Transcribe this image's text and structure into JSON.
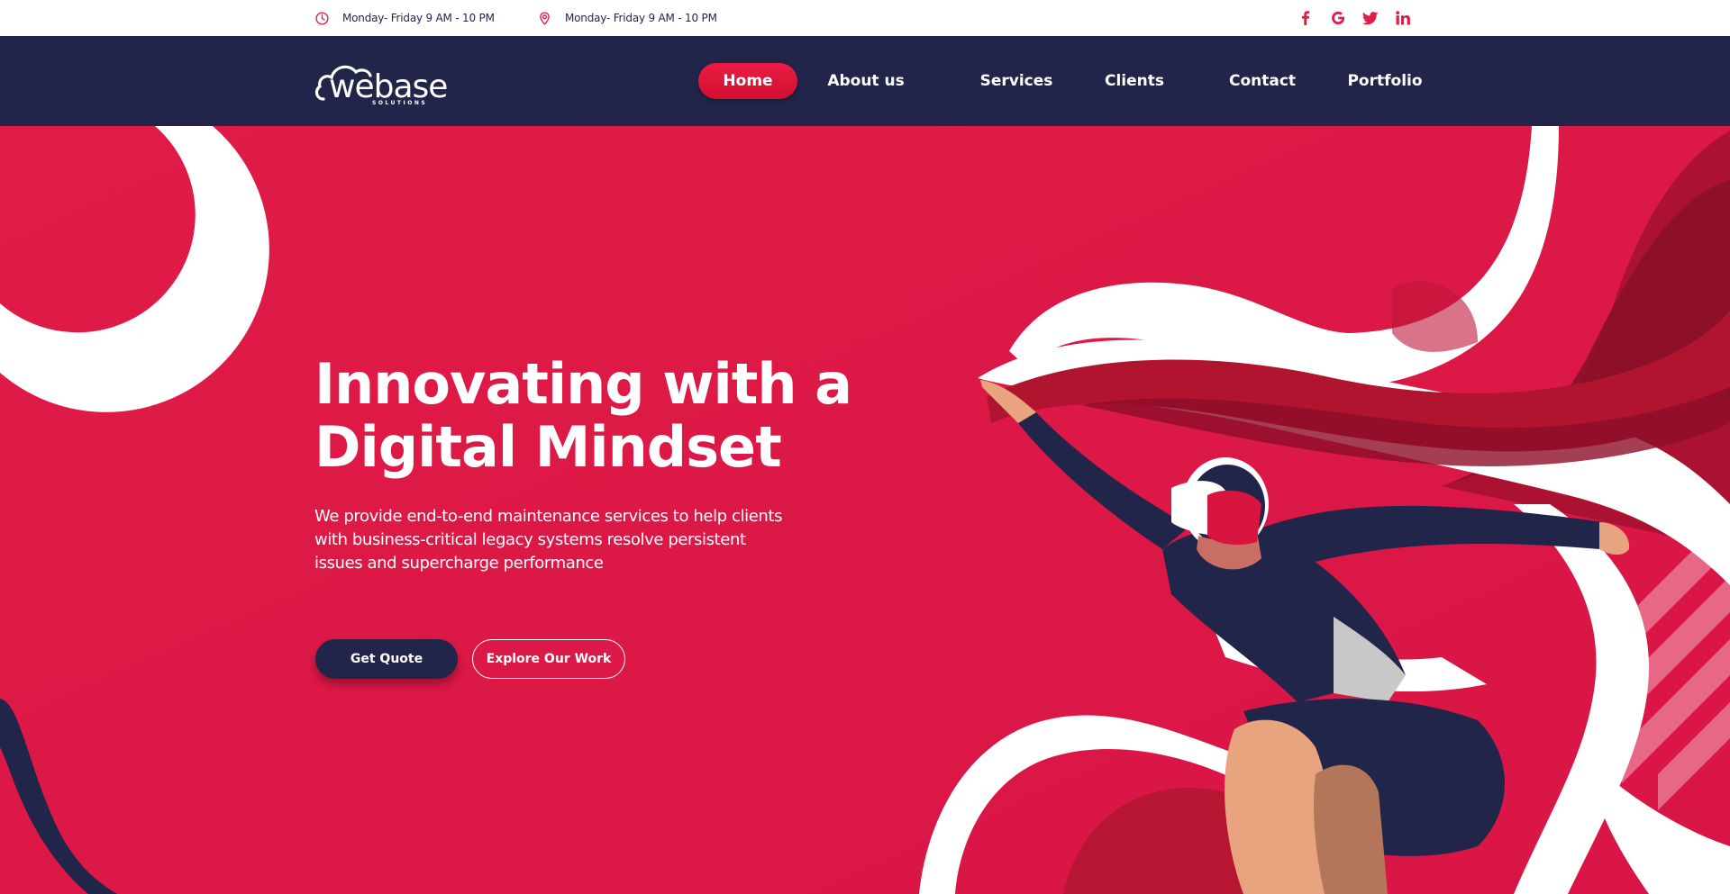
{
  "topbar": {
    "hours_text": "Monday- Friday 9 AM - 10 PM",
    "location_text": "Monday- Friday 9 AM - 10 PM",
    "hours_icon": "clock-icon",
    "location_icon": "map-pin-icon",
    "socials": [
      "facebook-icon",
      "google-icon",
      "twitter-icon",
      "linkedin-icon"
    ]
  },
  "nav": {
    "logo_text": "webase",
    "logo_subtext": "SOLUTIONS",
    "items": [
      {
        "label": "Home",
        "active": true
      },
      {
        "label": "About us",
        "active": false
      },
      {
        "label": "Services",
        "active": false
      },
      {
        "label": "Clients",
        "active": false
      },
      {
        "label": "Contact",
        "active": false
      },
      {
        "label": "Portfolio",
        "active": false
      }
    ]
  },
  "hero": {
    "title_line1": "Innovating with a",
    "title_line2": "Digital Mindset",
    "description": "We provide end-to-end maintenance services to help clients with business-critical legacy systems resolve persistent issues and supercharge performance",
    "primary_button": "Get Quote",
    "secondary_button": "Explore Our Work"
  },
  "colors": {
    "brand_red": "#e11c47",
    "navy": "#22254a",
    "white": "#ffffff"
  }
}
